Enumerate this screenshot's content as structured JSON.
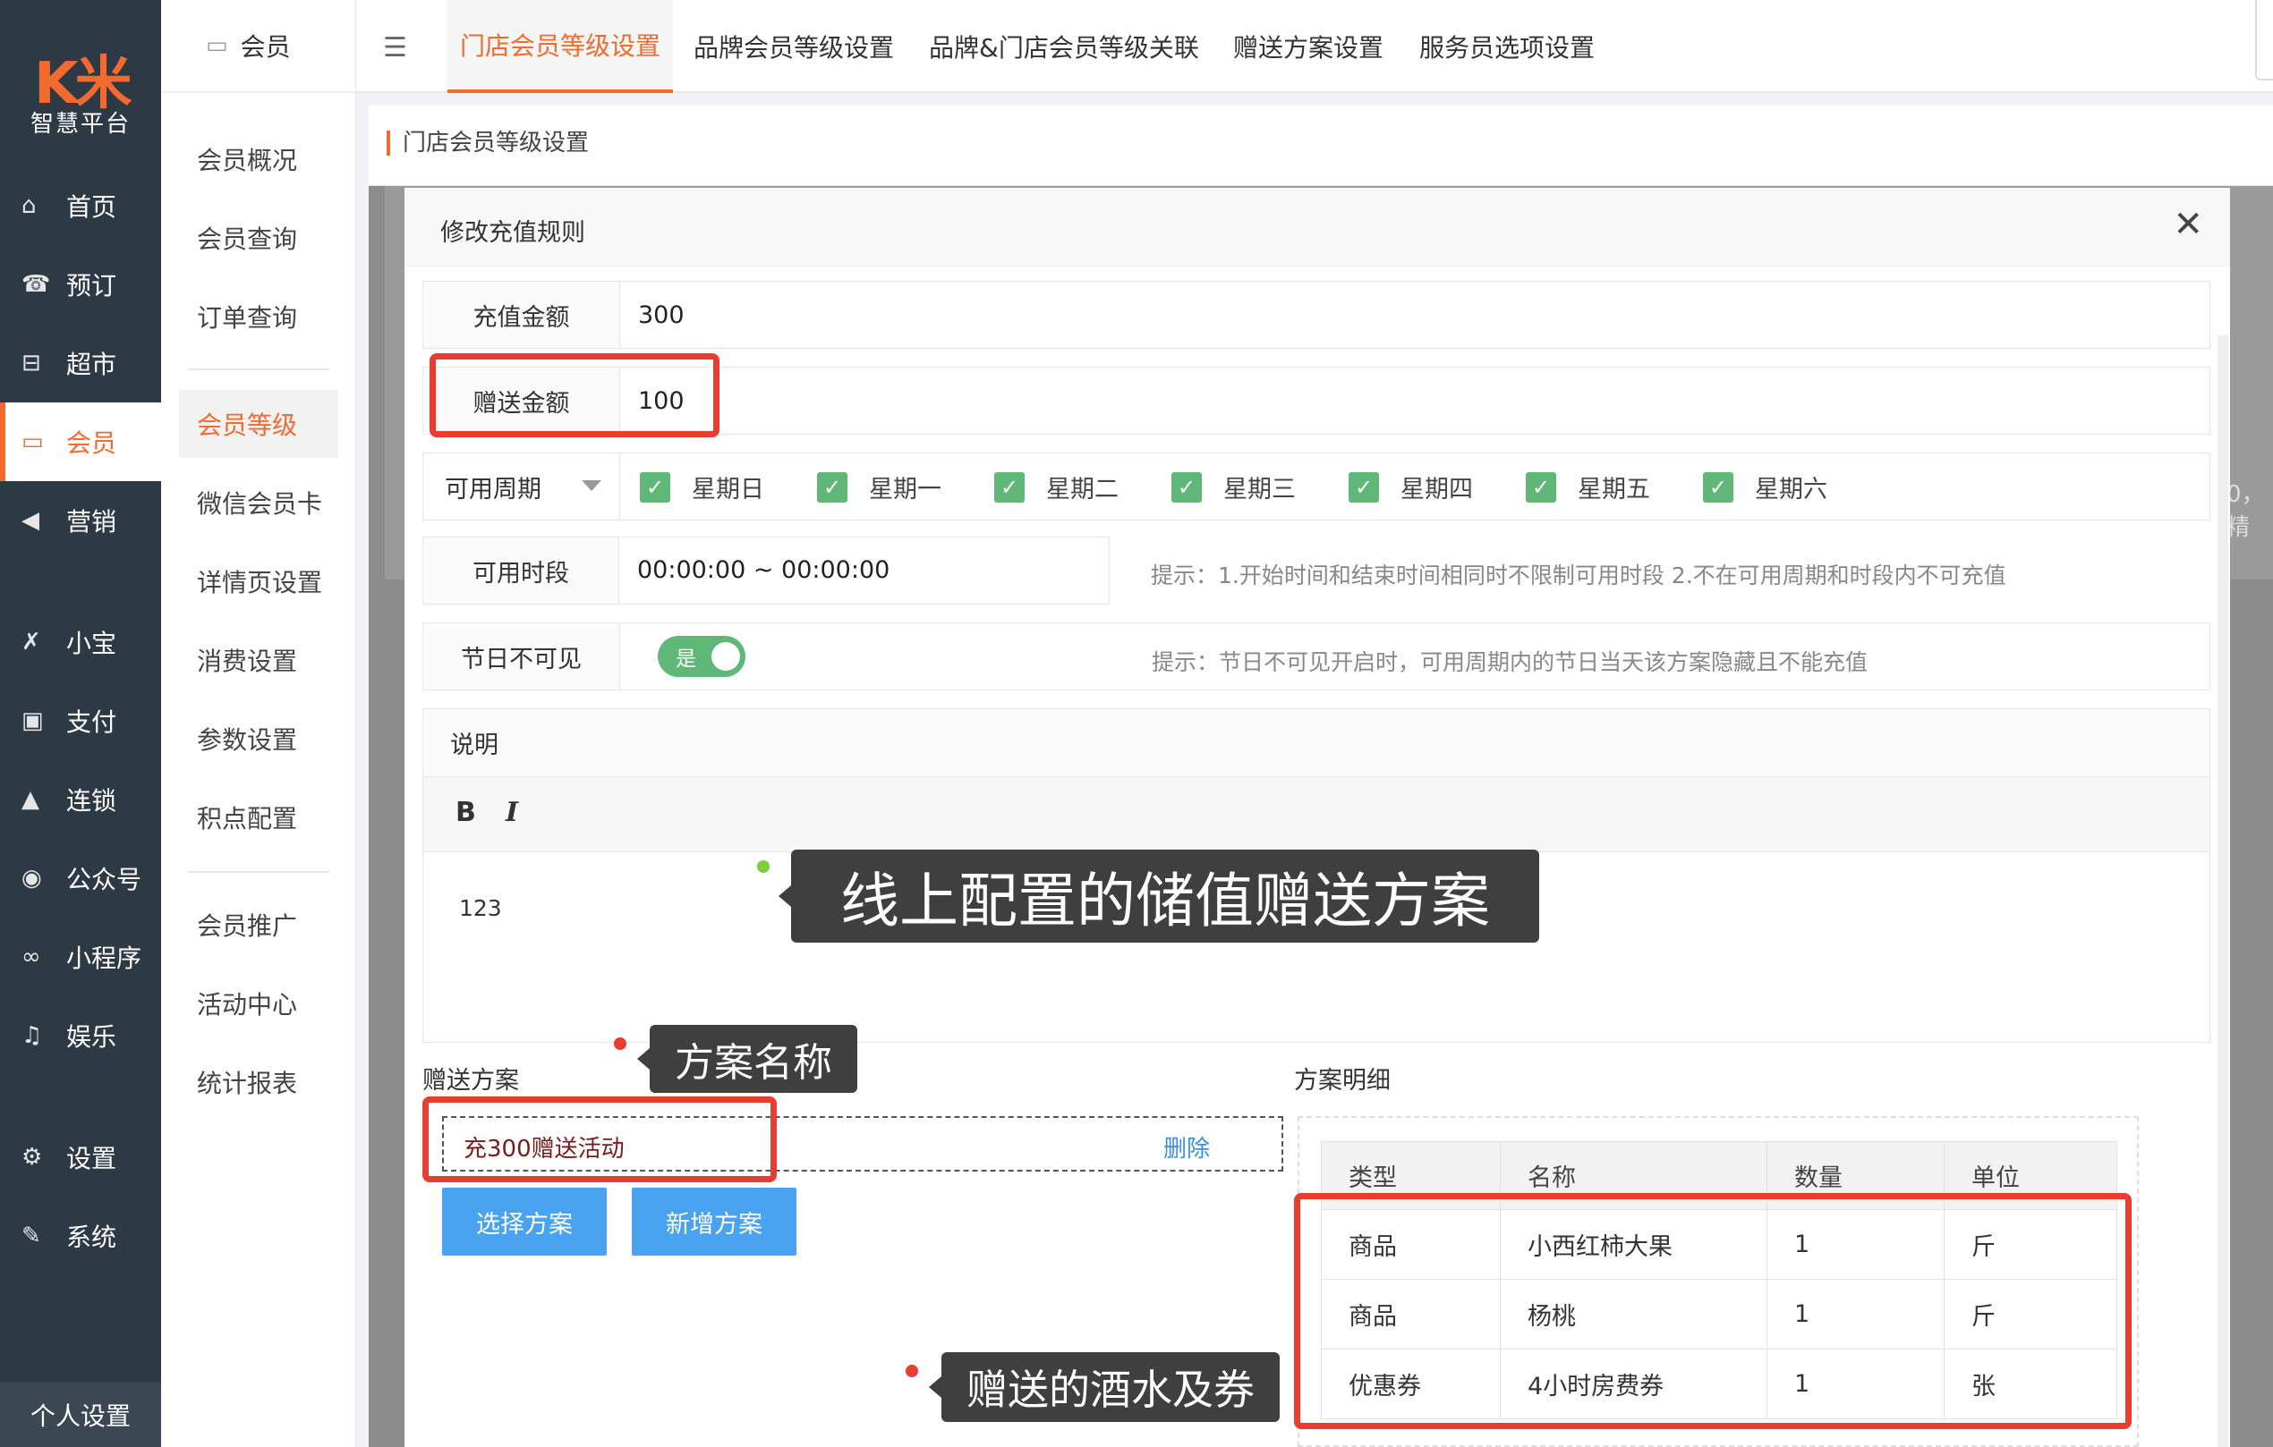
{
  "brand": {
    "logo": "K米",
    "subtitle": "智慧平台",
    "accent": "#f26a2e"
  },
  "sidebar": {
    "items": [
      {
        "label": "首页",
        "icon": "home-icon",
        "glyph": "⌂"
      },
      {
        "label": "预订",
        "icon": "phone-icon",
        "glyph": "☎"
      },
      {
        "label": "超市",
        "icon": "basket-icon",
        "glyph": "⊟"
      },
      {
        "label": "会员",
        "icon": "card-icon",
        "glyph": "▭"
      },
      {
        "label": "营销",
        "icon": "megaphone-icon",
        "glyph": "◀"
      },
      {
        "label": "小宝",
        "icon": "xiaobao-icon",
        "glyph": "✗"
      },
      {
        "label": "支付",
        "icon": "payment-icon",
        "glyph": "▣"
      },
      {
        "label": "连锁",
        "icon": "shop-icon",
        "glyph": "▲"
      },
      {
        "label": "公众号",
        "icon": "wechat-icon",
        "glyph": "◉"
      },
      {
        "label": "小程序",
        "icon": "miniprogram-icon",
        "glyph": "∞"
      },
      {
        "label": "娱乐",
        "icon": "music-icon",
        "glyph": "♫"
      },
      {
        "label": "设置",
        "icon": "gear-icon",
        "glyph": "⚙"
      },
      {
        "label": "系统",
        "icon": "wrench-icon",
        "glyph": "✎"
      }
    ],
    "footer": "个人设置"
  },
  "subsidebar": {
    "header": "会员",
    "items": [
      "会员概况",
      "会员查询",
      "订单查询",
      "会员等级",
      "微信会员卡",
      "详情页设置",
      "消费设置",
      "参数设置",
      "积点配置",
      "会员推广",
      "活动中心",
      "统计报表"
    ]
  },
  "tabs": [
    "门店会员等级设置",
    "品牌会员等级设置",
    "品牌&门店会员等级关联",
    "赠送方案设置",
    "服务员选项设置"
  ],
  "page_title": "门店会员等级设置",
  "backdrop_text": "0，精",
  "modal": {
    "title": "修改充值规则",
    "close": "✕",
    "recharge_label": "充值金额",
    "recharge_value": "300",
    "bonus_label": "赠送金额",
    "bonus_value": "100",
    "period_label": "可用周期",
    "days": [
      "星期日",
      "星期一",
      "星期二",
      "星期三",
      "星期四",
      "星期五",
      "星期六"
    ],
    "time_label": "可用时段",
    "time_value": "00:00:00 ~ 00:00:00",
    "time_hint": "提示：1.开始时间和结束时间相同时不限制可用时段   2.不在可用周期和时段内不可充值",
    "holiday_label": "节日不可见",
    "holiday_toggle": "是",
    "holiday_hint": "提示：节日不可见开启时，可用周期内的节日当天该方案隐藏且不能充值",
    "desc_label": "说明",
    "bold": "B",
    "italic": "I",
    "desc_text": "123",
    "plan_label": "赠送方案",
    "plan_name": "充300赠送活动",
    "plan_delete": "删除",
    "select_plan": "选择方案",
    "add_plan": "新增方案",
    "detail_label": "方案明细",
    "detail_headers": [
      "类型",
      "名称",
      "数量",
      "单位"
    ],
    "detail_rows": [
      [
        "商品",
        "小西红柿大果",
        "1",
        "斤"
      ],
      [
        "商品",
        "杨桃",
        "1",
        "斤"
      ],
      [
        "优惠券",
        "4小时房费券",
        "1",
        "张"
      ]
    ]
  },
  "annotations": {
    "online_plan": "线上配置的储值赠送方案",
    "plan_name": "方案名称",
    "gifts": "赠送的酒水及券",
    "color": "#e83e2f"
  }
}
